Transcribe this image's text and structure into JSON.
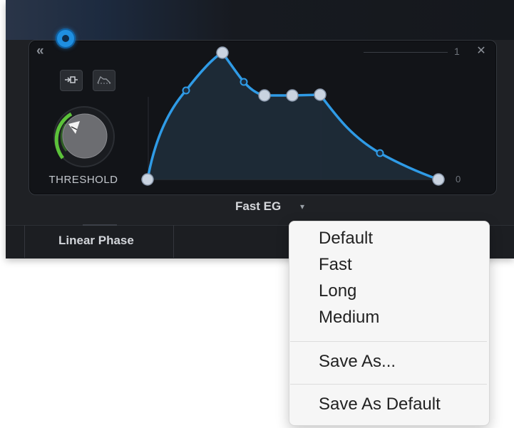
{
  "panel": {
    "band_number": "1",
    "collapse_icon": "double-chevron-left-icon",
    "close_icon": "close-icon",
    "threshold_label": "THRESHOLD",
    "axis_zero": "0"
  },
  "preset": {
    "name": "Fast EG",
    "caret": "▾"
  },
  "tabs": [
    {
      "label": "Linear Phase"
    }
  ],
  "menu": {
    "items": [
      "Default",
      "Fast",
      "Long",
      "Medium"
    ],
    "save_as": "Save As...",
    "save_as_default": "Save As Default"
  },
  "colors": {
    "accent": "#2f9be6",
    "knob_arc": "#5cc23a",
    "background": "#1f2125"
  }
}
